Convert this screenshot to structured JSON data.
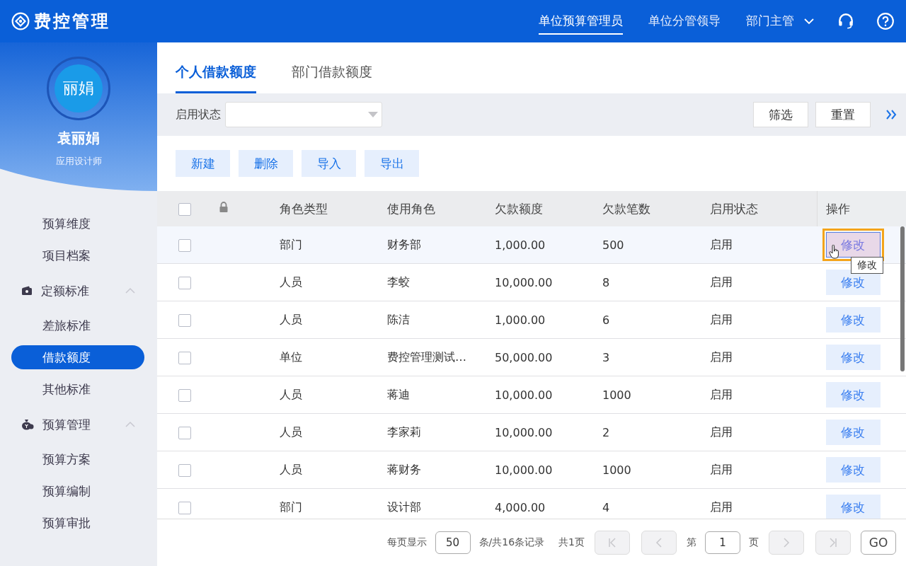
{
  "app": {
    "title": "费控管理"
  },
  "roles": [
    {
      "label": "单位预算管理员",
      "selected": true
    },
    {
      "label": "单位分管领导",
      "selected": false
    },
    {
      "label": "部门主管",
      "selected": false
    }
  ],
  "user": {
    "avatar_text": "丽娟",
    "name": "袁丽娟",
    "role": "应用设计师"
  },
  "sidebar": {
    "items": [
      {
        "kind": "item",
        "label": "预算维度",
        "selected": false
      },
      {
        "kind": "item",
        "label": "项目档案",
        "selected": false
      },
      {
        "kind": "group",
        "label": "定额标准",
        "expanded": true,
        "children": [
          {
            "label": "差旅标准",
            "selected": false
          },
          {
            "label": "借款额度",
            "selected": true
          },
          {
            "label": "其他标准",
            "selected": false
          }
        ]
      },
      {
        "kind": "group",
        "label": "预算管理",
        "expanded": true,
        "children": [
          {
            "label": "预算方案",
            "selected": false
          },
          {
            "label": "预算编制",
            "selected": false
          },
          {
            "label": "预算审批",
            "selected": false
          }
        ]
      }
    ]
  },
  "tabs": [
    {
      "label": "个人借款额度",
      "selected": true
    },
    {
      "label": "部门借款额度",
      "selected": false
    }
  ],
  "filter": {
    "label": "启用状态",
    "buttons": [
      "筛选",
      "重置"
    ]
  },
  "toolbar": [
    "新建",
    "删除",
    "导入",
    "导出"
  ],
  "table": {
    "all_checked": false,
    "columns": [
      "角色类型",
      "使用角色",
      "欠款额度",
      "欠款笔数",
      "启用状态",
      "操作"
    ],
    "rows": [
      {
        "cells": [
          "部门",
          "财务部",
          "1,000.00",
          "500",
          "启用"
        ],
        "action": "修改",
        "checked": false,
        "hovered": true,
        "tooltip": "修改"
      },
      {
        "cells": [
          "人员",
          "李蛟",
          "10,000.00",
          "8",
          "启用"
        ],
        "action": "修改",
        "checked": false,
        "hovered": false
      },
      {
        "cells": [
          "人员",
          "陈洁",
          "1,000.00",
          "6",
          "启用"
        ],
        "action": "修改",
        "checked": false,
        "hovered": false
      },
      {
        "cells": [
          "单位",
          "费控管理测试…",
          "50,000.00",
          "3",
          "启用"
        ],
        "action": "修改",
        "checked": false,
        "hovered": false
      },
      {
        "cells": [
          "人员",
          "蒋迪",
          "10,000.00",
          "1000",
          "启用"
        ],
        "action": "修改",
        "checked": false,
        "hovered": false
      },
      {
        "cells": [
          "人员",
          "李家莉",
          "10,000.00",
          "2",
          "启用"
        ],
        "action": "修改",
        "checked": false,
        "hovered": false
      },
      {
        "cells": [
          "人员",
          "蒋财务",
          "10,000.00",
          "1000",
          "启用"
        ],
        "action": "修改",
        "checked": false,
        "hovered": false
      },
      {
        "cells": [
          "部门",
          "设计部",
          "4,000.00",
          "4",
          "启用"
        ],
        "action": "修改",
        "checked": false,
        "hovered": false
      }
    ]
  },
  "pagination": {
    "per_page_label": "每页显示",
    "per_page": "50",
    "records": "条/共16条记录",
    "pages": "共1页",
    "page_prefix": "第",
    "page": "1",
    "page_suffix": "页",
    "go": "GO"
  }
}
